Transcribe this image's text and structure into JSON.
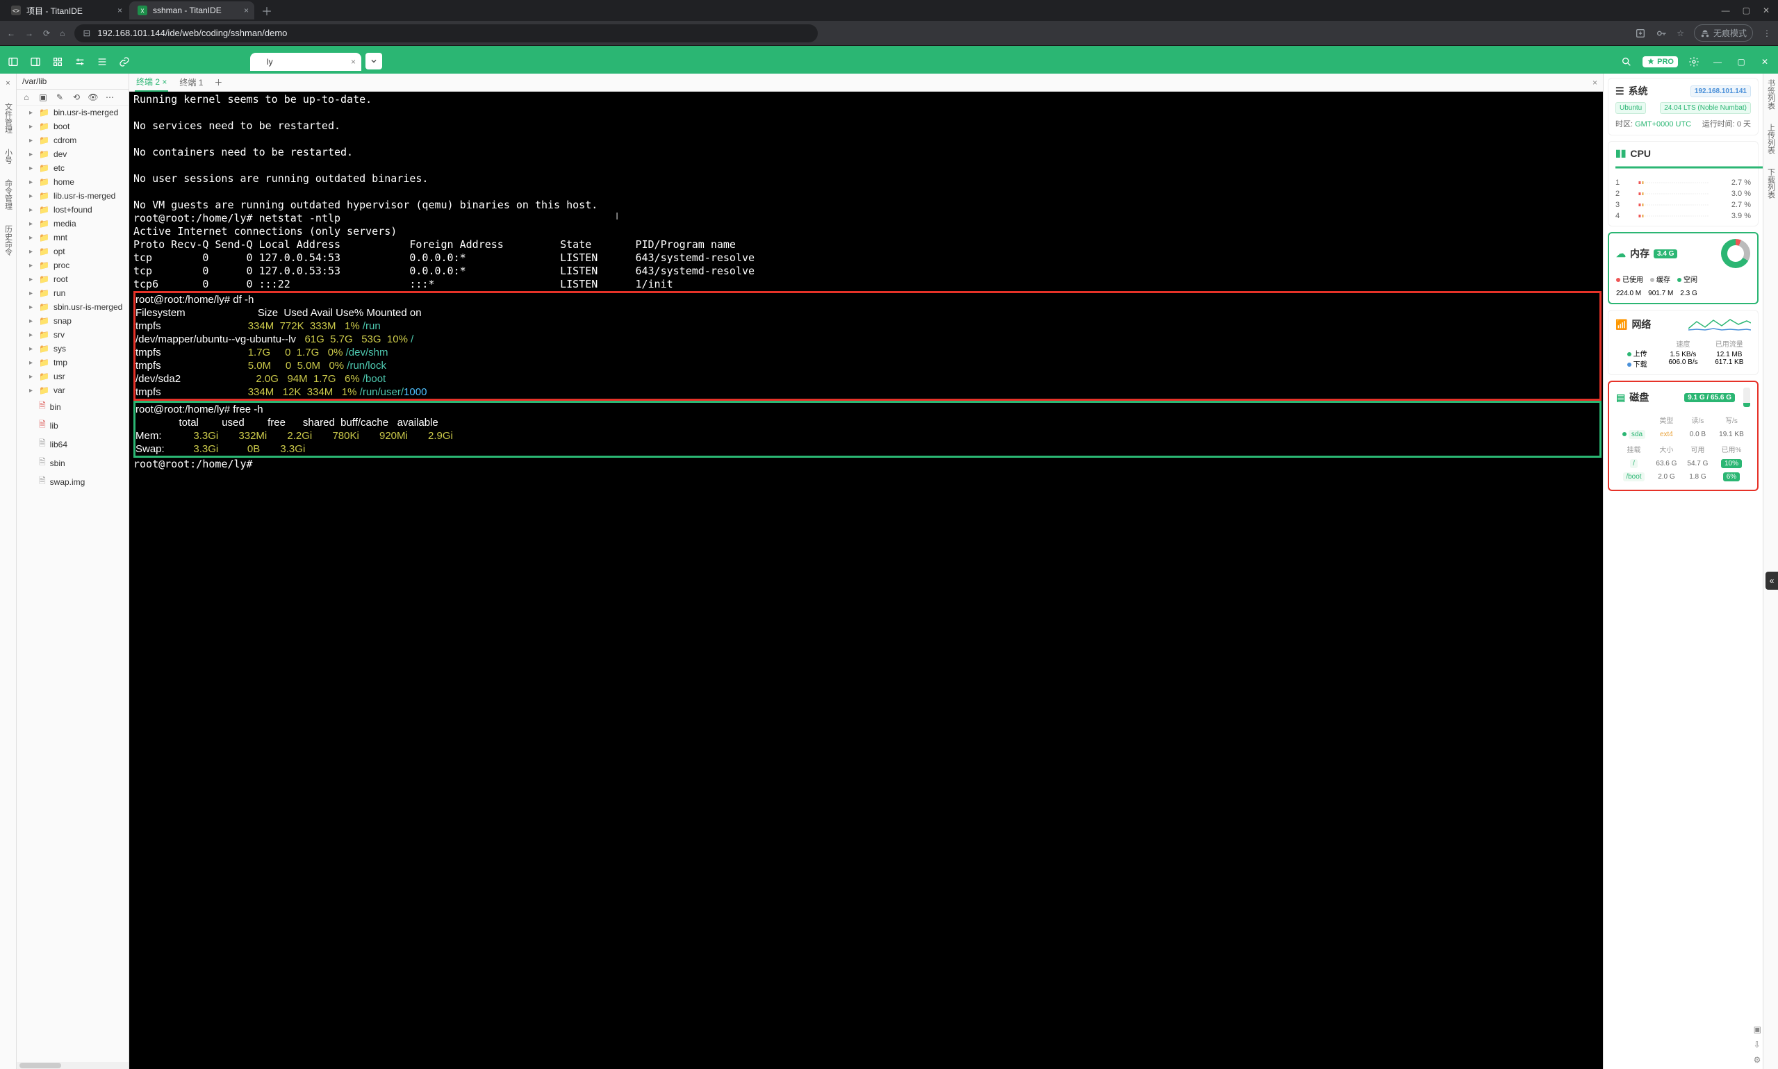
{
  "browser": {
    "tabs": [
      {
        "title": "项目 - TitanIDE",
        "fav": "code"
      },
      {
        "title": "sshman - TitanIDE",
        "fav": "xls"
      }
    ],
    "url": "192.168.101.144/ide/web/coding/sshman/demo",
    "incognito_label": "无痕模式"
  },
  "app": {
    "file_tab": "ly",
    "pro_label": "PRO"
  },
  "sidebar_rail": [
    "文件管理",
    "小号",
    "命令管理",
    "历史命令"
  ],
  "right_rail": [
    "书签列表",
    "上传列表",
    "下载列表"
  ],
  "filetree": {
    "path": "/var/lib",
    "items": [
      {
        "name": "bin.usr-is-merged",
        "type": "folder"
      },
      {
        "name": "boot",
        "type": "folder"
      },
      {
        "name": "cdrom",
        "type": "folder"
      },
      {
        "name": "dev",
        "type": "folder"
      },
      {
        "name": "etc",
        "type": "folder"
      },
      {
        "name": "home",
        "type": "folder"
      },
      {
        "name": "lib.usr-is-merged",
        "type": "folder"
      },
      {
        "name": "lost+found",
        "type": "folder"
      },
      {
        "name": "media",
        "type": "folder"
      },
      {
        "name": "mnt",
        "type": "folder"
      },
      {
        "name": "opt",
        "type": "folder"
      },
      {
        "name": "proc",
        "type": "folder"
      },
      {
        "name": "root",
        "type": "folder"
      },
      {
        "name": "run",
        "type": "folder"
      },
      {
        "name": "sbin.usr-is-merged",
        "type": "folder"
      },
      {
        "name": "snap",
        "type": "folder"
      },
      {
        "name": "srv",
        "type": "folder"
      },
      {
        "name": "sys",
        "type": "folder"
      },
      {
        "name": "tmp",
        "type": "folder-tmp"
      },
      {
        "name": "usr",
        "type": "folder"
      },
      {
        "name": "var",
        "type": "folder"
      },
      {
        "name": "bin",
        "type": "file-red"
      },
      {
        "name": "lib",
        "type": "file-red"
      },
      {
        "name": "lib64",
        "type": "file"
      },
      {
        "name": "sbin",
        "type": "file"
      },
      {
        "name": "swap.img",
        "type": "file"
      }
    ]
  },
  "terminal_tabs": {
    "t1_label": "终端 2",
    "t2_label": "终端 1"
  },
  "terminal": {
    "pre": "Running kernel seems to be up-to-date.\n\nNo services need to be restarted.\n\nNo containers need to be restarted.\n\nNo user sessions are running outdated binaries.\n\nNo VM guests are running outdated hypervisor (qemu) binaries on this host.",
    "prompt_netstat": "root@root:/home/ly# netstat -ntlp",
    "net_head": "Active Internet connections (only servers)\nProto Recv-Q Send-Q Local Address           Foreign Address         State       PID/Program name",
    "net1": "tcp        0      0 127.0.0.54:53           0.0.0.0:*               LISTEN      643/systemd-resolve",
    "net2": "tcp        0      0 127.0.0.53:53           0.0.0.0:*               LISTEN      643/systemd-resolve",
    "net3": "tcp6       0      0 :::22                   :::*                    LISTEN      1/init",
    "prompt_df": "root@root:/home/ly# df -h",
    "prompt_free": "root@root:/home/ly# free -h",
    "prompt_end": "root@root:/home/ly#"
  },
  "chart_data": {
    "df": {
      "type": "table",
      "columns": [
        "Filesystem",
        "Size",
        "Used",
        "Avail",
        "Use%",
        "Mounted on"
      ],
      "rows": [
        [
          "tmpfs",
          "334M",
          "772K",
          "333M",
          "1%",
          "/run"
        ],
        [
          "/dev/mapper/ubuntu--vg-ubuntu--lv",
          "61G",
          "5.7G",
          "53G",
          "10%",
          "/"
        ],
        [
          "tmpfs",
          "1.7G",
          "0",
          "1.7G",
          "0%",
          "/dev/shm"
        ],
        [
          "tmpfs",
          "5.0M",
          "0",
          "5.0M",
          "0%",
          "/run/lock"
        ],
        [
          "/dev/sda2",
          "2.0G",
          "94M",
          "1.7G",
          "6%",
          "/boot"
        ],
        [
          "tmpfs",
          "334M",
          "12K",
          "334M",
          "1%",
          "/run/user/1000"
        ]
      ]
    },
    "free": {
      "type": "table",
      "columns": [
        "",
        "total",
        "used",
        "free",
        "shared",
        "buff/cache",
        "available"
      ],
      "rows": [
        [
          "Mem:",
          "3.3Gi",
          "332Mi",
          "2.2Gi",
          "780Ki",
          "920Mi",
          "2.9Gi"
        ],
        [
          "Swap:",
          "3.3Gi",
          "0B",
          "3.3Gi",
          "",
          "",
          ""
        ]
      ]
    },
    "cpu_cores": {
      "type": "bar",
      "categories": [
        "1",
        "2",
        "3",
        "4"
      ],
      "values": [
        2.7,
        3.0,
        2.7,
        3.9
      ],
      "ylabel": "%"
    }
  },
  "info": {
    "system_title": "系统",
    "ip": "192.168.101.141",
    "os": "Ubuntu",
    "os_ver": "24.04 LTS (Noble Numbat)",
    "tz_label": "时区:",
    "tz": "GMT+0000  UTC",
    "uptime_label": "运行时间:",
    "uptime": "0 天",
    "cpu_title": "CPU",
    "mem_title": "内存",
    "mem_badge": "3.4 G",
    "mem_used_lbl": "已使用",
    "mem_cache_lbl": "缓存",
    "mem_free_lbl": "空闲",
    "mem_used": "224.0 M",
    "mem_cache": "901.7 M",
    "mem_free": "2.3 G",
    "net_title": "网络",
    "net_speed_lbl": "速度",
    "net_used_lbl": "已用流量",
    "net_up_lbl": "上传",
    "net_down_lbl": "下载",
    "net_up_speed": "1.5 KB/s",
    "net_down_speed": "606.0 B/s",
    "net_up_total": "12.1 MB",
    "net_down_total": "617.1 KB",
    "disk_title": "磁盘",
    "disk_badge": "9.1 G / 65.6 G",
    "disk_dev": "sda",
    "disk_fs": "ext4",
    "disk_read": "0.0 B",
    "disk_write": "19.1 KB",
    "th_type": "类型",
    "th_read": "读/s",
    "th_write": "写/s",
    "th_mount": "挂载",
    "th_size": "大小",
    "th_avail": "可用",
    "th_pct": "已用%",
    "mounts": [
      {
        "path": "/",
        "size": "63.6 G",
        "avail": "54.7 G",
        "pct": "10%"
      },
      {
        "path": "/boot",
        "size": "2.0 G",
        "avail": "1.8 G",
        "pct": "6%"
      }
    ]
  }
}
